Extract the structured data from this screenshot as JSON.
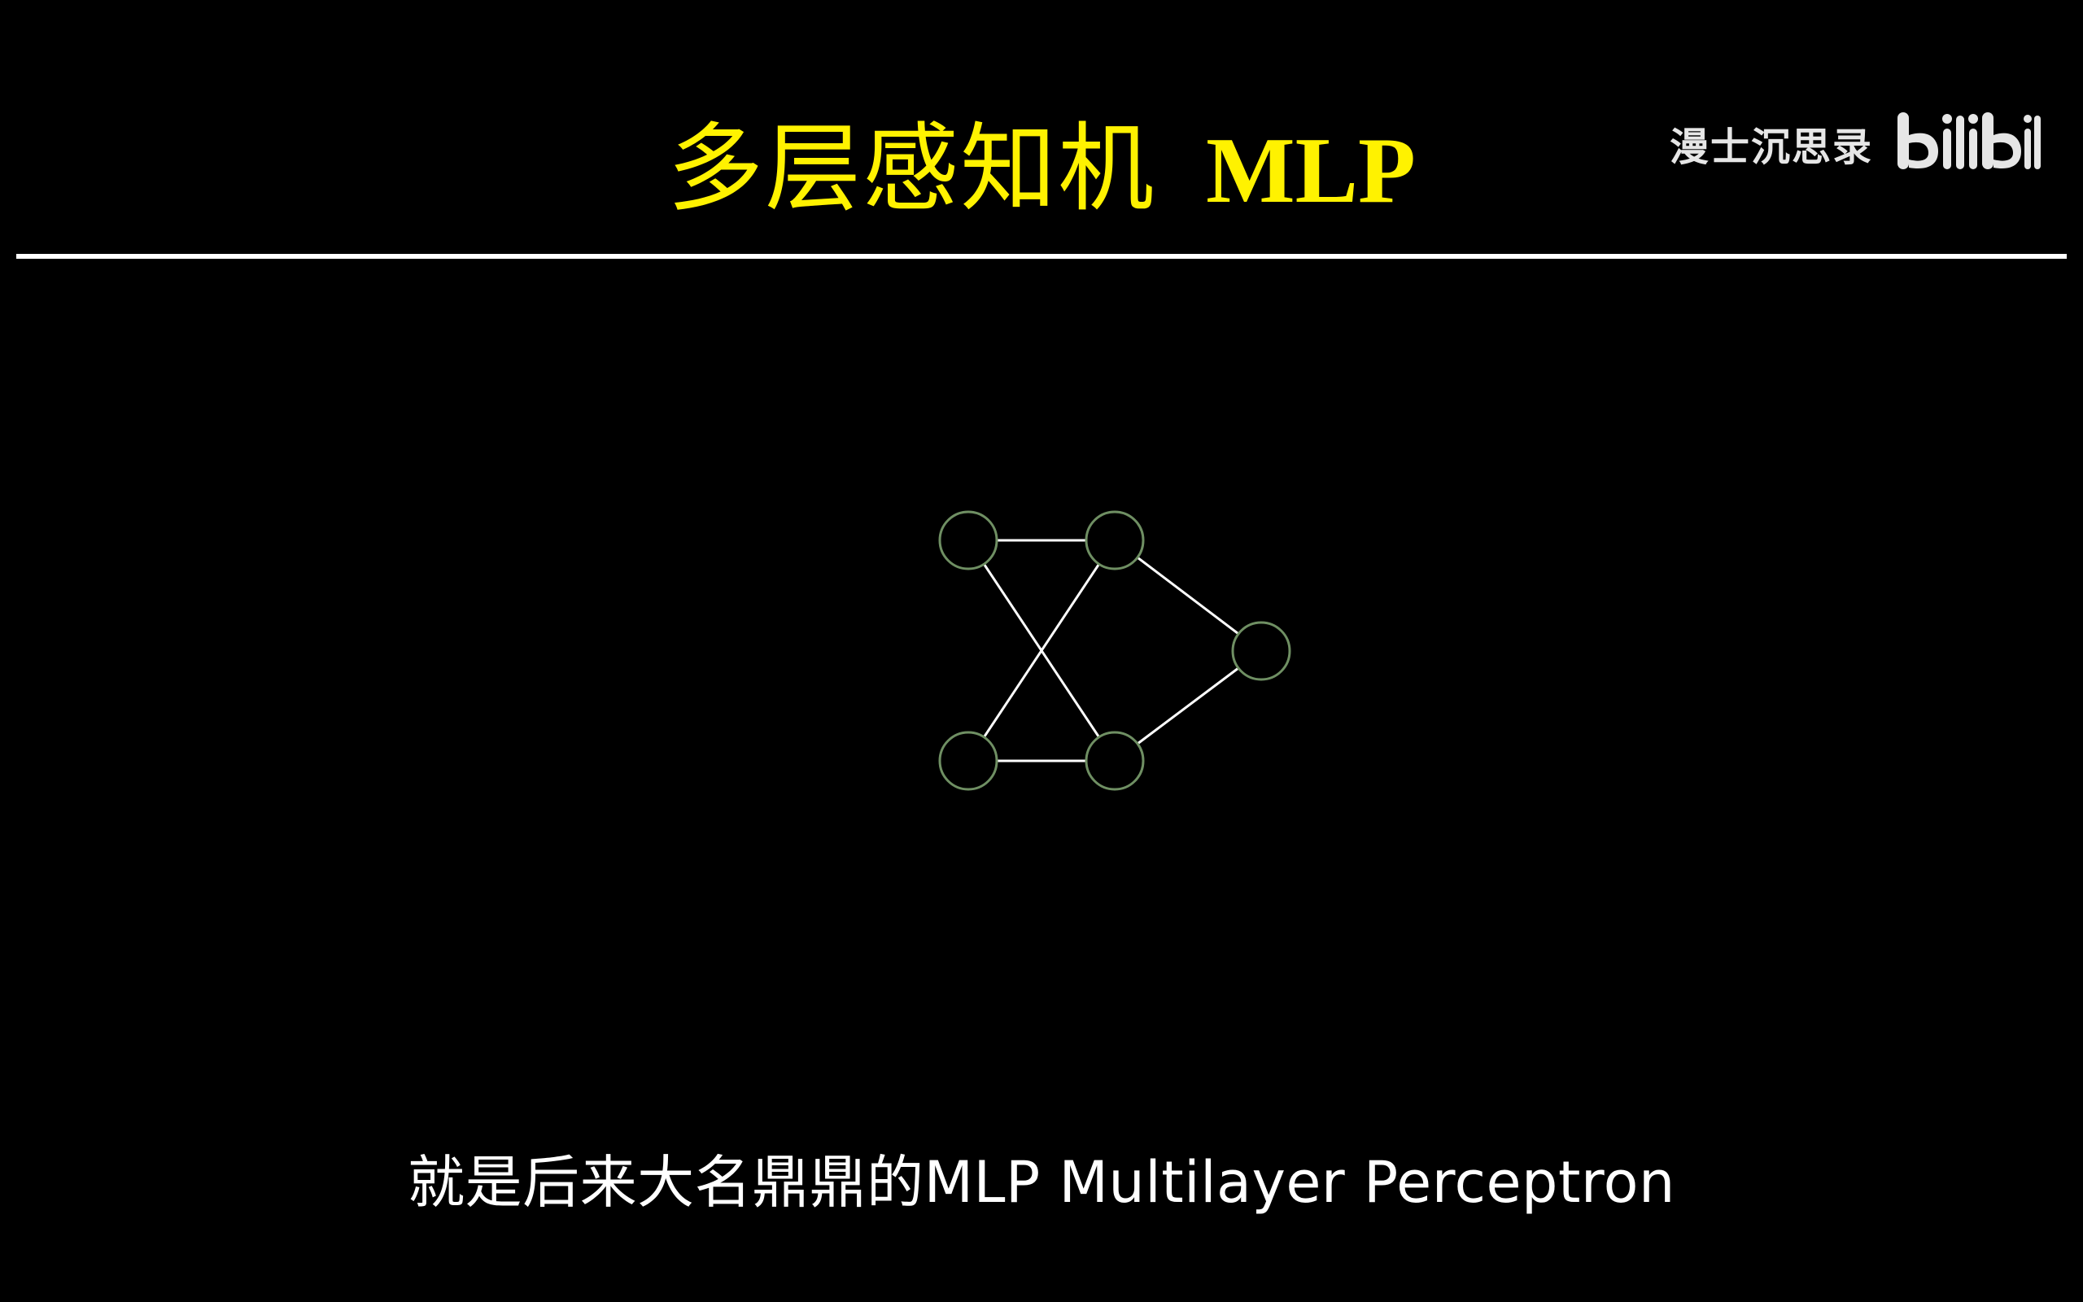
{
  "slide": {
    "title_zh": "多层感知机",
    "title_en": "MLP",
    "subtitle": "就是后来大名鼎鼎的MLP Multilayer Perceptron"
  },
  "watermark": {
    "channel": "漫士沉思录",
    "logo_text": "bilibili"
  },
  "diagram": {
    "node_stroke": "#6f8f63",
    "edge_color": "#ffffff",
    "nodes": [
      {
        "id": "in-1"
      },
      {
        "id": "in-2"
      },
      {
        "id": "hidden-1"
      },
      {
        "id": "hidden-2"
      },
      {
        "id": "out-1"
      }
    ],
    "edges": [
      [
        "in-1",
        "hidden-1"
      ],
      [
        "in-1",
        "hidden-2"
      ],
      [
        "in-2",
        "hidden-1"
      ],
      [
        "in-2",
        "hidden-2"
      ],
      [
        "hidden-1",
        "out-1"
      ],
      [
        "hidden-2",
        "out-1"
      ]
    ]
  },
  "colors": {
    "background": "#000000",
    "title": "#fff200",
    "subtitle": "#ffffff"
  }
}
